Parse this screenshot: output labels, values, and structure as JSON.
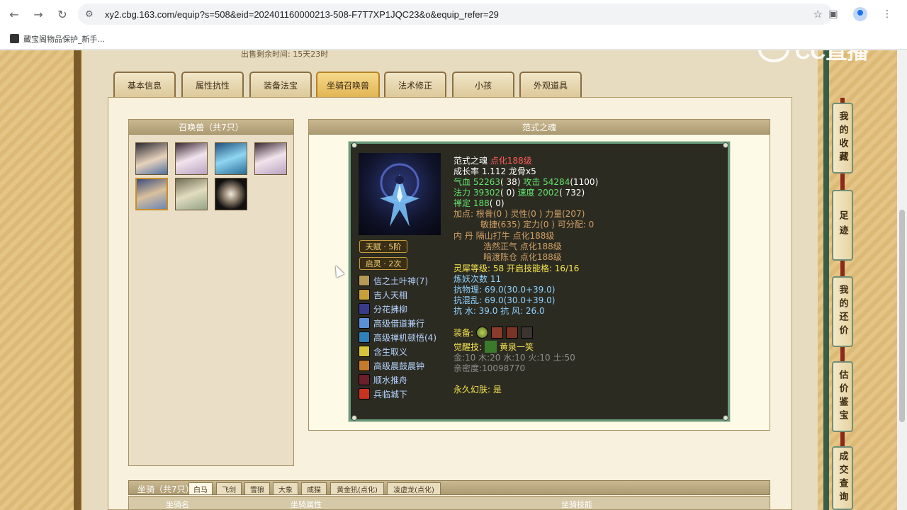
{
  "browser": {
    "url": "xy2.cbg.163.com/equip?s=508&eid=202401160000213-508-F7T7XP1JQC23&o&equip_refer=29",
    "bookmark": "藏宝阁物品保护_新手..."
  },
  "watermark": "CC直播",
  "top_cut_text": "出售剩余时间:  15天23时",
  "tabs": [
    "基本信息",
    "属性抗性",
    "装备法宝",
    "坐骑召唤兽",
    "法术修正",
    "小孩",
    "外观道具"
  ],
  "active_tab": "坐骑召唤兽",
  "pet_list": {
    "title": "召唤兽（共7只）",
    "count": 7
  },
  "detail": {
    "title": "范式之魂",
    "name": "范式之魂",
    "rank": "点化188级",
    "growth": "成长率 1.112 龙骨x5",
    "hp_label": "气血",
    "hp": "52263",
    "hp_extra": "( 38)",
    "atk_label": "攻击",
    "atk": "54284",
    "atk_extra": "(1100)",
    "mp_label": "法力",
    "mp": "39302",
    "mp_extra": "( 0)",
    "spd_label": "速度",
    "spd": "2002",
    "spd_extra": "( 732)",
    "zen_label": "禅定",
    "zen": "188",
    "zen_extra": "( 0)",
    "points_1": "加点:  根骨(0 ) 灵性(0 ) 力量(207)",
    "points_2": "敏捷(635) 定力(0 ) 可分配:   0",
    "inner_label": "内    丹",
    "inner_1": "隔山打牛 点化188级",
    "inner_2": "浩然正气 点化188级",
    "inner_3": "暗渡陈仓 点化188级",
    "spirit": "灵犀等级:  58 开启技能格:  16/16",
    "refine": "炼妖次数 11",
    "res_phys": "抗物理: 69.0(30.0+39.0)",
    "res_chaos": "抗混乱: 69.0(30.0+39.0)",
    "res_elem": "抗    水: 39.0 抗    风: 26.0",
    "equip_label": "装备:",
    "awaken_label": "觉醒技:",
    "awaken_skill": "黄泉一笑",
    "elements": "金:10 木:20 水:10 火:10 土:50",
    "intimacy": "亲密度:10098770",
    "permanent_skin": "永久幻肤: 是",
    "talent": "天赋 · 5阶",
    "qiling": "启灵 · 2次",
    "skills": [
      "信之土叶神(7)",
      "吉人天相",
      "分花拂柳",
      "高级借道兼行",
      "高级禅机顿悟(4)",
      "含生取义",
      "高级晨鼓晨钟",
      "顺水推舟",
      "兵临城下"
    ]
  },
  "mount": {
    "title": "坐骑（共7只）",
    "tabs": [
      "白马",
      "飞剑",
      "雪狼",
      "大象",
      "咸猫",
      "黄金犼(点化)",
      "凌虚龙(点化)"
    ],
    "columns": [
      "坐骑名",
      "坐骑属性",
      "坐骑技能"
    ]
  },
  "side_buttons": [
    "我的收藏",
    "足迹",
    "我的还价",
    "估价鉴宝",
    "成交查询"
  ],
  "colors": {
    "accent_green": "#63e36b",
    "rank_red": "#ff5b5b",
    "card_bg": "#2c2b22"
  }
}
